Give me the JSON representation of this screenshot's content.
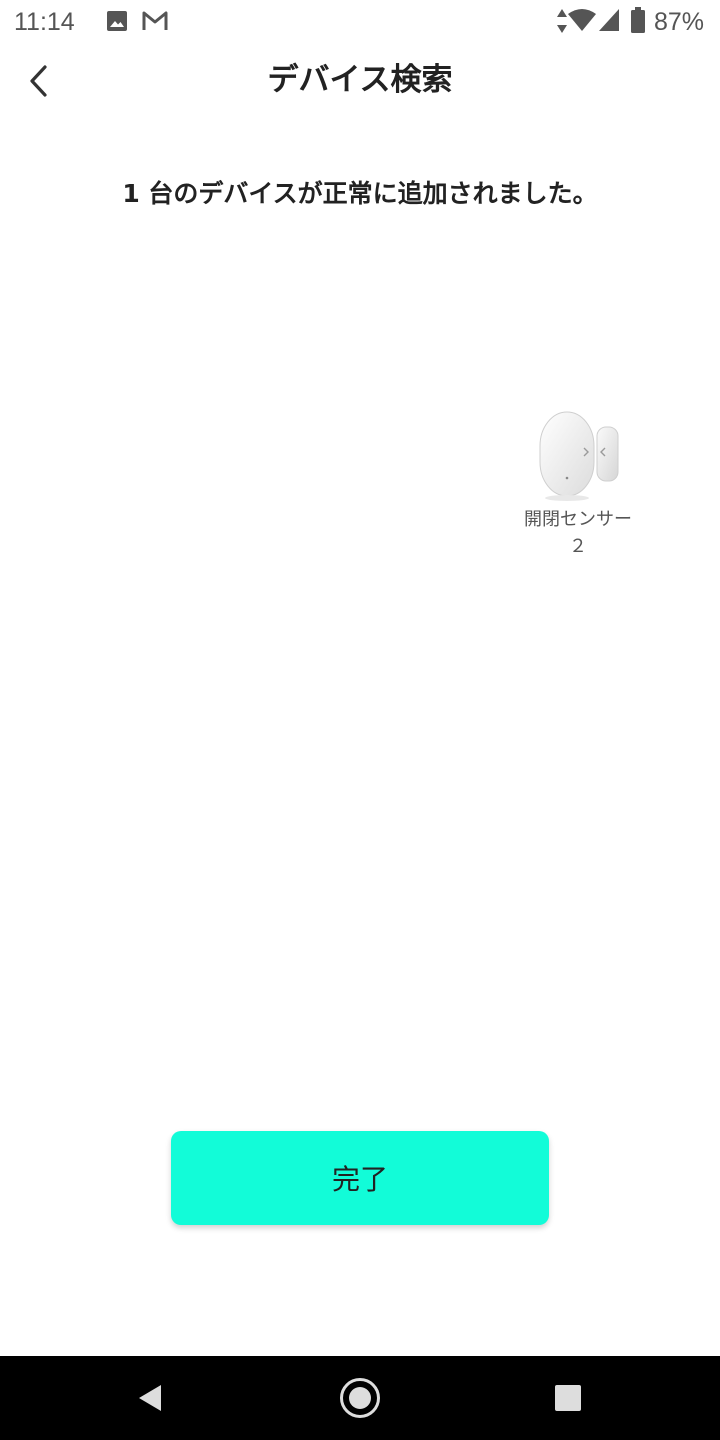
{
  "status_bar": {
    "time": "11:14",
    "battery": "87%",
    "icons": [
      "image-icon",
      "gmail-icon",
      "data-arrows-icon",
      "wifi-icon",
      "cell-signal-icon",
      "battery-icon"
    ]
  },
  "header": {
    "title": "デバイス検索",
    "back_icon": "chevron-left-icon"
  },
  "message": "1 台のデバイスが正常に追加されました。",
  "devices": [
    {
      "name": "開閉センサー２",
      "icon": "door-sensor-icon"
    }
  ],
  "done_button": {
    "label": "完了",
    "color": "#12fcd8"
  },
  "nav_bar": {
    "buttons": [
      "back-triangle-icon",
      "home-circle-icon",
      "recents-square-icon"
    ]
  }
}
